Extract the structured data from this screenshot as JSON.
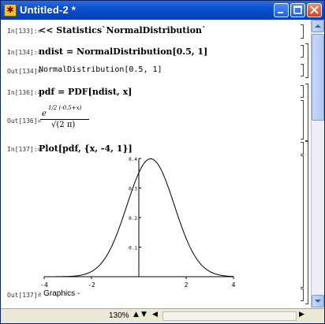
{
  "window": {
    "title": "Untitled-2 *"
  },
  "cells": [
    {
      "in_label": "In[133]:=",
      "code": "<< Statistics`NormalDistribution`"
    },
    {
      "in_label": "In[134]:=",
      "code": "ndist = NormalDistribution[0.5, 1]"
    },
    {
      "out_label": "Out[134]=",
      "output": "NormalDistribution[0.5, 1]"
    },
    {
      "in_label": "In[136]:=",
      "code": "pdf = PDF[ndist, x]"
    },
    {
      "out_label": "Out[136]=",
      "output_exp": "1/2 (-0.5+x)",
      "output_den": "√(2 π)"
    },
    {
      "in_label": "In[137]:=",
      "code": "Plot[pdf, {x, -4, 1}]"
    },
    {
      "out_label": "Out[137]=",
      "output": "- Graphics -"
    }
  ],
  "chart_data": {
    "type": "line",
    "title": "",
    "xlabel": "",
    "ylabel": "",
    "xlim": [
      -4,
      4
    ],
    "ylim": [
      0,
      0.4
    ],
    "x_ticks": [
      "-4",
      "-2",
      "2",
      "4"
    ],
    "y_ticks": [
      "0.1",
      "0.2",
      "0.3",
      "0.4"
    ],
    "series": [
      {
        "mean": 0.5,
        "sd": 1
      }
    ]
  },
  "status": {
    "zoom": "130%"
  },
  "icons": {
    "app": "mathematica-icon",
    "min": "minimize-icon",
    "max": "maximize-icon",
    "close": "close-icon"
  }
}
